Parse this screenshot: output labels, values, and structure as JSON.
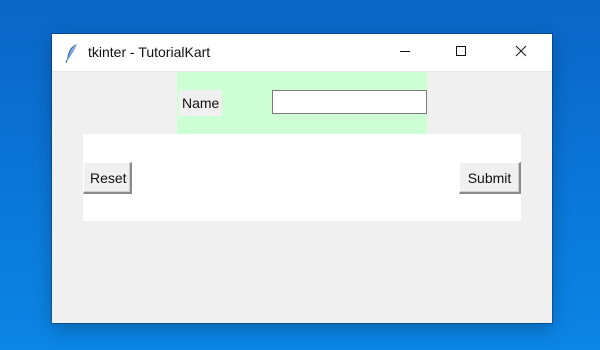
{
  "window": {
    "title": "tkinter - TutorialKart",
    "controls": {
      "minimize": "minimize-icon",
      "maximize": "maximize-icon",
      "close": "close-icon"
    }
  },
  "form": {
    "name_label": "Name",
    "name_value": "",
    "reset_label": "Reset",
    "submit_label": "Submit"
  },
  "colors": {
    "desktop": "#0a72d4",
    "window_bg": "#f0f0f0",
    "green_frame": "#ccffd4",
    "white_frame": "#ffffff"
  }
}
